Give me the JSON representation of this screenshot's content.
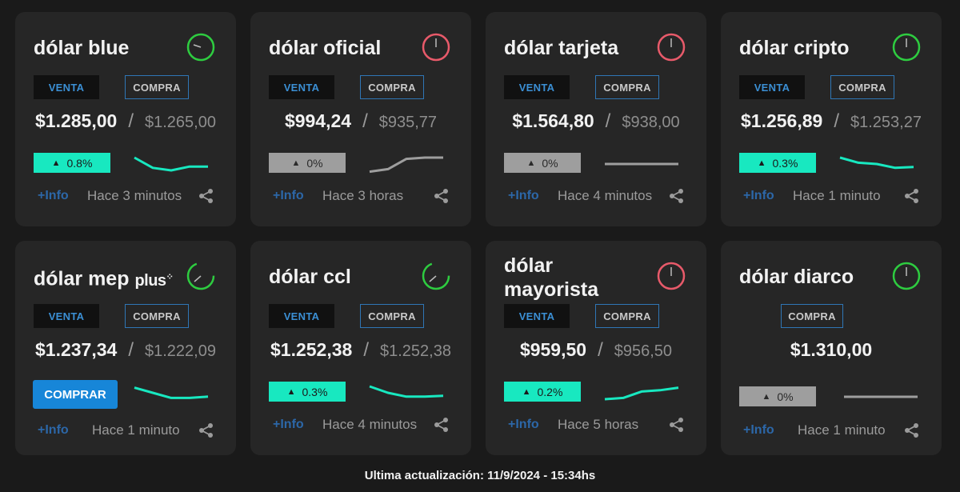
{
  "colors": {
    "background": "#1a1a1a",
    "card": "#262626",
    "accent_up": "#18e8c0",
    "flat": "#9e9e9e",
    "blue": "#1786d8",
    "timer_green": "#2ecc40",
    "timer_red": "#e85a6a"
  },
  "labels": {
    "venta": "VENTA",
    "compra": "COMPRA",
    "info": "+Info",
    "comprar": "COMPRAR"
  },
  "cards": [
    {
      "title": "dólar blue",
      "sell": "$1.285,00",
      "buy": "$1.265,00",
      "variation": "0.8%",
      "trend": "up",
      "updated": "Hace 3 minutos",
      "timer": "green",
      "spark": [
        0.75,
        0.35,
        0.25,
        0.4,
        0.4
      ]
    },
    {
      "title": "dólar oficial",
      "sell": "$994,24",
      "buy": "$935,77",
      "variation": "0%",
      "trend": "flat",
      "updated": "Hace 3 horas",
      "timer": "red",
      "spark": [
        0.2,
        0.3,
        0.7,
        0.75,
        0.75
      ]
    },
    {
      "title": "dólar tarjeta",
      "sell": "$1.564,80",
      "buy": "$938,00",
      "variation": "0%",
      "trend": "flat",
      "updated": "Hace 4 minutos",
      "timer": "red",
      "spark": [
        0.5,
        0.5,
        0.5,
        0.5,
        0.5
      ]
    },
    {
      "title": "dólar cripto",
      "sell": "$1.256,89",
      "buy": "$1.253,27",
      "variation": "0.3%",
      "trend": "up",
      "updated": "Hace 1 minuto",
      "timer": "green",
      "spark": [
        0.75,
        0.55,
        0.5,
        0.35,
        0.38
      ]
    },
    {
      "title": "dólar mep",
      "title_plus": "plus",
      "sell": "$1.237,34",
      "buy": "$1.222,09",
      "comprar": true,
      "updated": "Hace 1 minuto",
      "timer": "green",
      "spark": [
        0.7,
        0.5,
        0.3,
        0.3,
        0.35
      ]
    },
    {
      "title": "dólar ccl",
      "sell": "$1.252,38",
      "buy": "$1.252,38",
      "variation": "0.3%",
      "trend": "up",
      "updated": "Hace 4 minutos",
      "timer": "green",
      "spark": [
        0.75,
        0.5,
        0.35,
        0.35,
        0.38
      ]
    },
    {
      "title": "dólar mayorista",
      "sell": "$959,50",
      "buy": "$956,50",
      "variation": "0.2%",
      "trend": "up",
      "updated": "Hace 5 horas",
      "timer": "red",
      "spark": [
        0.25,
        0.3,
        0.55,
        0.6,
        0.7
      ]
    },
    {
      "title": "dólar diarco",
      "buy": "$1.310,00",
      "variation": "0%",
      "trend": "flat",
      "updated": "Hace 1 minuto",
      "timer": "green",
      "compra_only": true,
      "spark": [
        0.5,
        0.5,
        0.5,
        0.5,
        0.5
      ]
    }
  ],
  "footer": {
    "last_update": "Ultima actualización: 11/9/2024 - 15:34hs"
  }
}
